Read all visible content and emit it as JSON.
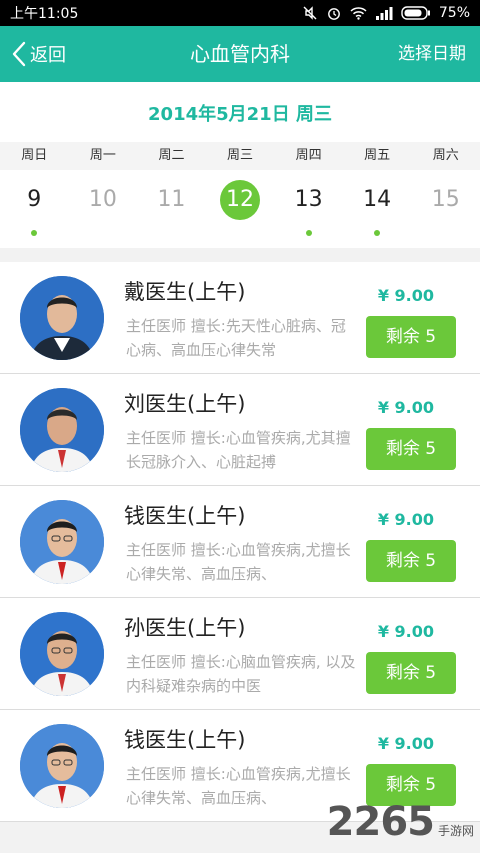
{
  "status": {
    "time": "上午11:05",
    "battery": "75%"
  },
  "header": {
    "back_label": "返回",
    "title": "心血管内科",
    "pick_date": "选择日期"
  },
  "calendar": {
    "date_label": "2014年5月21日  周三",
    "weekdays": [
      "周日",
      "周一",
      "周二",
      "周三",
      "周四",
      "周五",
      "周六"
    ],
    "days": [
      {
        "num": "9",
        "dot": true
      },
      {
        "num": "10",
        "dot": false
      },
      {
        "num": "11",
        "dot": false
      },
      {
        "num": "12",
        "dot": false,
        "selected": true
      },
      {
        "num": "13",
        "dot": true
      },
      {
        "num": "14",
        "dot": true
      },
      {
        "num": "15",
        "dot": false
      }
    ],
    "accent": "#1fb8a0",
    "selected_color": "#6bc83a"
  },
  "doctors": [
    {
      "name": "戴医生(上午)",
      "desc": "主任医师  擅长:先天性心脏病、冠心病、高血压心律失常",
      "price": "¥ 9.00",
      "remain": "剩余 5"
    },
    {
      "name": "刘医生(上午)",
      "desc": "主任医师  擅长:心血管疾病,尤其擅长冠脉介入、心脏起搏",
      "price": "¥ 9.00",
      "remain": "剩余 5"
    },
    {
      "name": "钱医生(上午)",
      "desc": "主任医师  擅长:心血管疾病,尤擅长心律失常、高血压病、",
      "price": "¥ 9.00",
      "remain": "剩余 5"
    },
    {
      "name": "孙医生(上午)",
      "desc": "主任医师  擅长:心脑血管疾病, 以及内科疑难杂病的中医",
      "price": "¥ 9.00",
      "remain": "剩余 5"
    },
    {
      "name": "钱医生(上午)",
      "desc": "主任医师  擅长:心血管疾病,尤擅长心律失常、高血压病、",
      "price": "¥ 9.00",
      "remain": "剩余 5"
    }
  ],
  "watermark": {
    "number": "2265",
    "text": "手游网"
  }
}
